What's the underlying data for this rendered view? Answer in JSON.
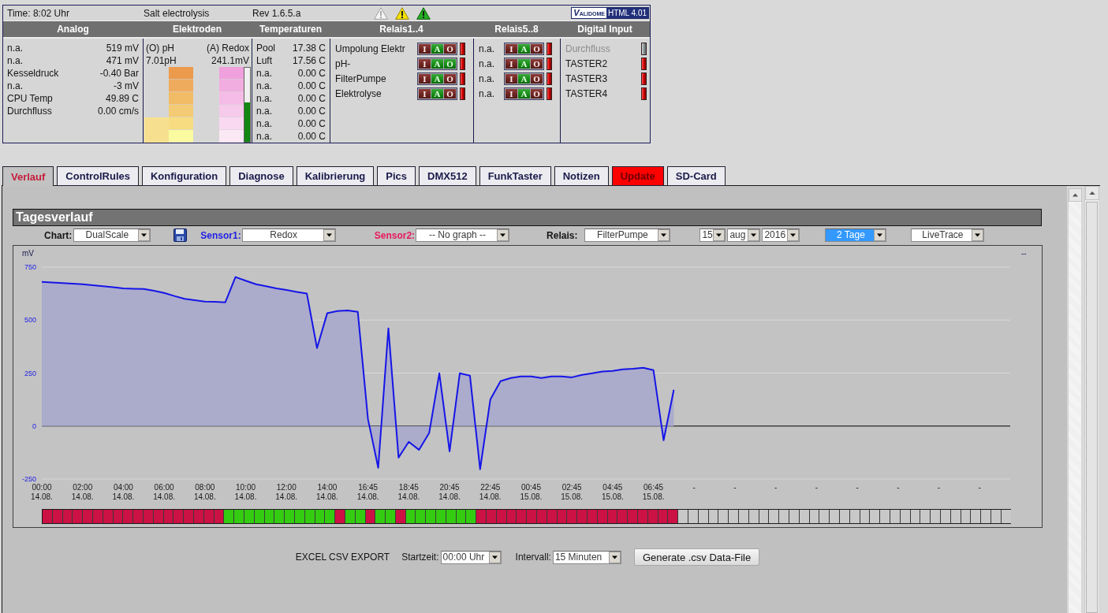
{
  "header": {
    "time": "Time: 8:02 Uhr",
    "title": "Salt electrolysis",
    "revision": "Rev 1.6.5.a",
    "validator": {
      "logo": "VALIDOME",
      "label": "HTML 4.01"
    }
  },
  "columns": [
    "Analog",
    "Elektroden",
    "Temperaturen",
    "Relais1..4",
    "Relais5..8",
    "Digital Input"
  ],
  "analog": [
    {
      "label": "n.a.",
      "value": "519 mV"
    },
    {
      "label": "n.a.",
      "value": "471 mV"
    },
    {
      "label": "Kesseldruck",
      "value": "-0.40 Bar"
    },
    {
      "label": "n.a.",
      "value": "-3 mV"
    },
    {
      "label": "CPU Temp",
      "value": "49.89 C"
    },
    {
      "label": "Durchfluss",
      "value": "0.00 cm/s"
    }
  ],
  "electrodes": [
    {
      "kind": "ph",
      "label": "(O) pH",
      "value": "7.01pH"
    },
    {
      "kind": "redox",
      "label": "(A) Redox",
      "value": "241.1mV",
      "level": 0.53
    }
  ],
  "temperatures": [
    {
      "label": "Pool",
      "value": "17.38 C"
    },
    {
      "label": "Luft",
      "value": "17.56 C"
    },
    {
      "label": "n.a.",
      "value": "0.00 C"
    },
    {
      "label": "n.a.",
      "value": "0.00 C"
    },
    {
      "label": "n.a.",
      "value": "0.00 C"
    },
    {
      "label": "n.a.",
      "value": "0.00 C"
    },
    {
      "label": "n.a.",
      "value": "0.00 C"
    },
    {
      "label": "n.a.",
      "value": "0.00 C"
    }
  ],
  "relays_1_4": [
    {
      "name": "Umpolung Elektr",
      "on": false,
      "modes": [
        {
          "label": "I",
          "on": false
        },
        {
          "label": "A",
          "on": true
        },
        {
          "label": "O",
          "on": false
        }
      ]
    },
    {
      "name": "pH-",
      "on": false,
      "modes": [
        {
          "label": "I",
          "on": false
        },
        {
          "label": "A",
          "on": true
        },
        {
          "label": "O",
          "on": true
        }
      ]
    },
    {
      "name": "FilterPumpe",
      "on": false,
      "modes": [
        {
          "label": "I",
          "on": false
        },
        {
          "label": "A",
          "on": true
        },
        {
          "label": "O",
          "on": false
        }
      ]
    },
    {
      "name": "Elektrolyse",
      "on": false,
      "modes": [
        {
          "label": "I",
          "on": false
        },
        {
          "label": "A",
          "on": true
        },
        {
          "label": "O",
          "on": false
        }
      ]
    }
  ],
  "relays_5_8": [
    {
      "name": "n.a.",
      "on": false,
      "modes": [
        {
          "label": "I",
          "on": false
        },
        {
          "label": "A",
          "on": true
        },
        {
          "label": "O",
          "on": false
        }
      ]
    },
    {
      "name": "n.a.",
      "on": false,
      "modes": [
        {
          "label": "I",
          "on": false
        },
        {
          "label": "A",
          "on": true
        },
        {
          "label": "O",
          "on": false
        }
      ]
    },
    {
      "name": "n.a.",
      "on": false,
      "modes": [
        {
          "label": "I",
          "on": false
        },
        {
          "label": "A",
          "on": true
        },
        {
          "label": "O",
          "on": false
        }
      ]
    },
    {
      "name": "n.a.",
      "on": false,
      "modes": [
        {
          "label": "I",
          "on": false
        },
        {
          "label": "A",
          "on": true
        },
        {
          "label": "O",
          "on": false
        }
      ]
    }
  ],
  "digital_inputs": [
    {
      "name": "Durchfluss",
      "disabled": true,
      "on": false
    },
    {
      "name": "TASTER2",
      "disabled": false,
      "on": false
    },
    {
      "name": "TASTER3",
      "disabled": false,
      "on": false
    },
    {
      "name": "TASTER4",
      "disabled": false,
      "on": false
    }
  ],
  "tabs": [
    {
      "label": "Verlauf",
      "selected": true,
      "highlight": false
    },
    {
      "label": "ControlRules",
      "selected": false,
      "highlight": false
    },
    {
      "label": "Konfiguration",
      "selected": false,
      "highlight": false
    },
    {
      "label": "Diagnose",
      "selected": false,
      "highlight": false
    },
    {
      "label": "Kalibrierung",
      "selected": false,
      "highlight": false
    },
    {
      "label": "Pics",
      "selected": false,
      "highlight": false
    },
    {
      "label": "DMX512",
      "selected": false,
      "highlight": false
    },
    {
      "label": "FunkTaster",
      "selected": false,
      "highlight": false
    },
    {
      "label": "Notizen",
      "selected": false,
      "highlight": false
    },
    {
      "label": "Update",
      "selected": false,
      "highlight": true
    },
    {
      "label": "SD-Card",
      "selected": false,
      "highlight": false
    }
  ],
  "panel": {
    "title": "Tagesverlauf",
    "toolbar": [
      {
        "kind": "select",
        "label": "Chart:",
        "value": "DualScale",
        "focused": false
      },
      {
        "kind": "save"
      },
      {
        "kind": "select",
        "label": "Sensor1:",
        "color": "#1f1fe6",
        "value": "Redox",
        "focused": false
      },
      {
        "kind": "select",
        "label": "Sensor2:",
        "color": "#e8185c",
        "value": "-- No graph --",
        "focused": false
      },
      {
        "kind": "select",
        "label": "Relais:",
        "value": "FilterPumpe",
        "focused": false
      },
      {
        "kind": "select",
        "value": "15",
        "focused": false
      },
      {
        "kind": "select",
        "value": "aug",
        "focused": false
      },
      {
        "kind": "select",
        "value": "2016",
        "focused": false
      },
      {
        "kind": "select",
        "value": "2 Tage",
        "focused": true
      },
      {
        "kind": "select",
        "value": "LiveTrace",
        "focused": false
      }
    ],
    "chart": {
      "secondary_axis_label": "--",
      "chart_data": {
        "type": "area",
        "ylabel": "mV",
        "categories": [
          "00:00\n14.08.",
          null,
          null,
          null,
          "02:00\n14.08.",
          null,
          null,
          null,
          "04:00\n14.08.",
          null,
          null,
          null,
          "06:00\n14.08.",
          null,
          null,
          null,
          "08:00\n14.08.",
          null,
          null,
          null,
          "10:00\n14.08.",
          null,
          null,
          null,
          "12:00\n14.08.",
          null,
          null,
          null,
          "14:00\n14.08.",
          null,
          null,
          null,
          "16:45\n14.08.",
          null,
          null,
          null,
          "18:45\n14.08.",
          null,
          null,
          null,
          "20:45\n14.08.",
          null,
          null,
          null,
          "22:45\n14.08.",
          null,
          null,
          null,
          "00:45\n15.08.",
          null,
          null,
          null,
          "02:45\n15.08.",
          null,
          null,
          null,
          "04:45\n15.08.",
          null,
          null,
          null,
          "06:45\n15.08.",
          null,
          null,
          null,
          "-",
          null,
          null,
          null,
          "-",
          null,
          null,
          null,
          "-",
          null,
          null,
          null,
          "-",
          null,
          null,
          null,
          "-",
          null,
          null,
          null,
          "-",
          null,
          null,
          null,
          "-",
          null,
          null,
          null,
          "-",
          null,
          null,
          null
        ],
        "series": [
          {
            "color": "#1515e8",
            "values": [
              680,
              677,
              675,
              672,
              669,
              664,
              660,
              655,
              650,
              648,
              647,
              638,
              628,
              614,
              600,
              594,
              587,
              586,
              584,
              703,
              686,
              669,
              660,
              650,
              642,
              633,
              625,
              368,
              532,
              543,
              546,
              539,
              33,
              -197,
              461,
              -149,
              -74,
              -112,
              -33,
              249,
              -119,
              249,
              238,
              -204,
              126,
              212,
              227,
              234,
              234,
              227,
              234,
              234,
              230,
              242,
              249,
              257,
              260,
              268,
              271,
              275,
              264,
              -67,
              171,
              null,
              null,
              null,
              null,
              null,
              null,
              null,
              null,
              null,
              null,
              null,
              null,
              null,
              null,
              null,
              null,
              null,
              null,
              null,
              null,
              null,
              null,
              null,
              null,
              null,
              null,
              null,
              null,
              null,
              null,
              null,
              null,
              null
            ]
          }
        ],
        "ylim": [
          -250,
          750
        ],
        "yticks": [
          -250,
          0,
          250,
          500,
          750
        ]
      },
      "relay_timeline": [
        {
          "color": "#cc1144"
        },
        {
          "color": "#cc1144"
        },
        {
          "color": "#cc1144"
        },
        {
          "color": "#cc1144"
        },
        {
          "color": "#cc1144"
        },
        {
          "color": "#cc1144"
        },
        {
          "color": "#cc1144"
        },
        {
          "color": "#cc1144"
        },
        {
          "color": "#cc1144"
        },
        {
          "color": "#cc1144"
        },
        {
          "color": "#cc1144"
        },
        {
          "color": "#cc1144"
        },
        {
          "color": "#cc1144"
        },
        {
          "color": "#cc1144"
        },
        {
          "color": "#cc1144"
        },
        {
          "color": "#cc1144"
        },
        {
          "color": "#cc1144"
        },
        {
          "color": "#cc1144"
        },
        {
          "color": "#33cc11"
        },
        {
          "color": "#33cc11"
        },
        {
          "color": "#33cc11"
        },
        {
          "color": "#33cc11"
        },
        {
          "color": "#33cc11"
        },
        {
          "color": "#33cc11"
        },
        {
          "color": "#33cc11"
        },
        {
          "color": "#33cc11"
        },
        {
          "color": "#33cc11"
        },
        {
          "color": "#33cc11"
        },
        {
          "color": "#33cc11"
        },
        {
          "color": "#cc1144"
        },
        {
          "color": "#33cc11"
        },
        {
          "color": "#33cc11"
        },
        {
          "color": "#cc1144"
        },
        {
          "color": "#33cc11"
        },
        {
          "color": "#33cc11"
        },
        {
          "color": "#cc1144"
        },
        {
          "color": "#33cc11"
        },
        {
          "color": "#33cc11"
        },
        {
          "color": "#33cc11"
        },
        {
          "color": "#33cc11"
        },
        {
          "color": "#33cc11"
        },
        {
          "color": "#33cc11"
        },
        {
          "color": "#33cc11"
        },
        {
          "color": "#cc1144"
        },
        {
          "color": "#cc1144"
        },
        {
          "color": "#cc1144"
        },
        {
          "color": "#cc1144"
        },
        {
          "color": "#cc1144"
        },
        {
          "color": "#cc1144"
        },
        {
          "color": "#cc1144"
        },
        {
          "color": "#cc1144"
        },
        {
          "color": "#cc1144"
        },
        {
          "color": "#cc1144"
        },
        {
          "color": "#cc1144"
        },
        {
          "color": "#cc1144"
        },
        {
          "color": "#cc1144"
        },
        {
          "color": "#cc1144"
        },
        {
          "color": "#cc1144"
        },
        {
          "color": "#cc1144"
        },
        {
          "color": "#cc1144"
        },
        {
          "color": "#cc1144"
        },
        {
          "color": "#cc1144"
        },
        {
          "color": "#cc1144"
        },
        {
          "color": "#c8c8c8"
        },
        {
          "color": "#c8c8c8"
        },
        {
          "color": "#c8c8c8"
        },
        {
          "color": "#c8c8c8"
        },
        {
          "color": "#c8c8c8"
        },
        {
          "color": "#c8c8c8"
        },
        {
          "color": "#c8c8c8"
        },
        {
          "color": "#c8c8c8"
        },
        {
          "color": "#c8c8c8"
        },
        {
          "color": "#c8c8c8"
        },
        {
          "color": "#c8c8c8"
        },
        {
          "color": "#c8c8c8"
        },
        {
          "color": "#c8c8c8"
        },
        {
          "color": "#c8c8c8"
        },
        {
          "color": "#c8c8c8"
        },
        {
          "color": "#c8c8c8"
        },
        {
          "color": "#c8c8c8"
        },
        {
          "color": "#c8c8c8"
        },
        {
          "color": "#c8c8c8"
        },
        {
          "color": "#c8c8c8"
        },
        {
          "color": "#c8c8c8"
        },
        {
          "color": "#c8c8c8"
        },
        {
          "color": "#c8c8c8"
        },
        {
          "color": "#c8c8c8"
        },
        {
          "color": "#c8c8c8"
        },
        {
          "color": "#c8c8c8"
        },
        {
          "color": "#c8c8c8"
        },
        {
          "color": "#c8c8c8"
        },
        {
          "color": "#c8c8c8"
        },
        {
          "color": "#c8c8c8"
        },
        {
          "color": "#c8c8c8"
        },
        {
          "color": "#c8c8c8"
        },
        {
          "color": "#c8c8c8"
        }
      ]
    },
    "export": {
      "title": "EXCEL CSV EXPORT",
      "fields": [
        {
          "label": "Startzeit:",
          "value": "00:00 Uhr"
        },
        {
          "label": "Intervall:",
          "value": "15 Minuten"
        }
      ],
      "button": "Generate .csv Data-File"
    }
  }
}
